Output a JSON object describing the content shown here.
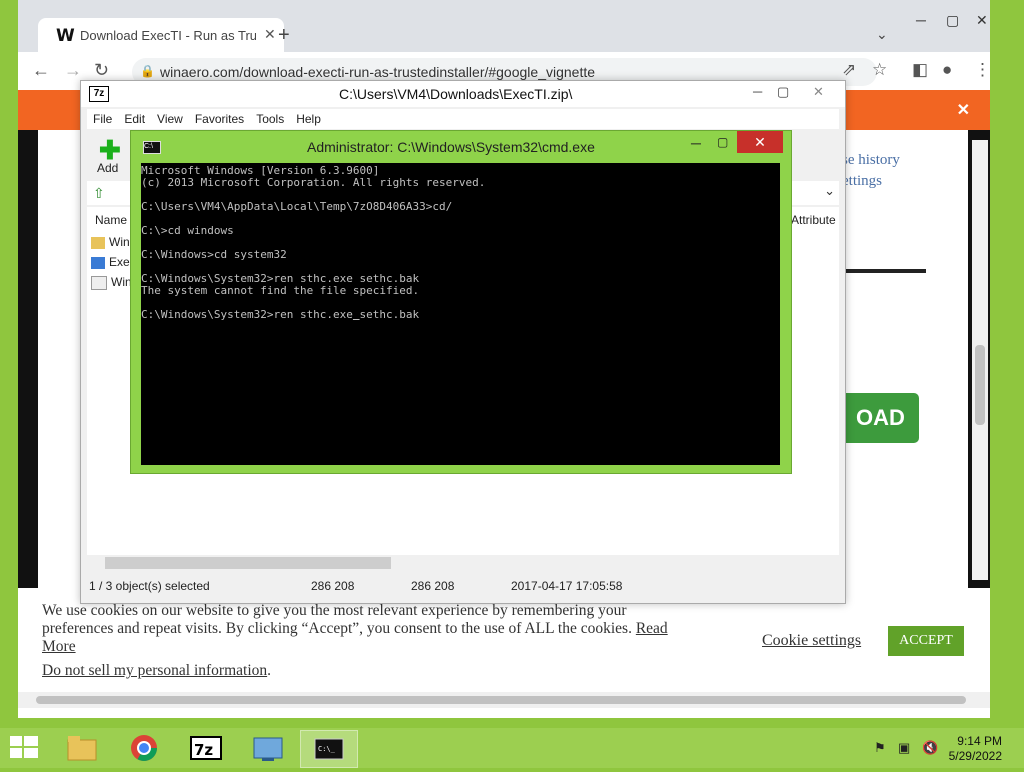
{
  "browser": {
    "tab_title": "Download ExecTI - Run as TrustedInstaller",
    "tab_favicon": "W",
    "url": "winaero.com/download-execti-run-as-trustedinstaller/#google_vignette"
  },
  "web": {
    "link1": "se history",
    "link2": "ettings",
    "download_label": "OAD",
    "cookie_message": "We use cookies on our website to give you the most relevant experience by remembering your preferences and repeat visits. By clicking “Accept”, you consent to the use of ALL the cookies.",
    "read_more": "Read More",
    "do_not_sell": "Do not sell my personal information",
    "cookie_settings": "Cookie settings",
    "accept": "ACCEPT"
  },
  "zip": {
    "title": "C:\\Users\\VM4\\Downloads\\ExecTI.zip\\",
    "menu": [
      "File",
      "Edit",
      "View",
      "Favorites",
      "Tools",
      "Help"
    ],
    "add_label": "Add",
    "col_name": "Name",
    "col_attributes": "Attribute",
    "rows": [
      "Win",
      "Exec",
      "Win"
    ],
    "status_selected": "1 / 3 object(s) selected",
    "status_size1": "286 208",
    "status_size2": "286 208",
    "status_date": "2017-04-17 17:05:58"
  },
  "cmd": {
    "title": "Administrator: C:\\Windows\\System32\\cmd.exe",
    "lines": [
      "Microsoft Windows [Version 6.3.9600]",
      "(c) 2013 Microsoft Corporation. All rights reserved.",
      "",
      "C:\\Users\\VM4\\AppData\\Local\\Temp\\7zO8D406A33>cd/",
      "",
      "C:\\>cd windows",
      "",
      "C:\\Windows>cd system32",
      "",
      "C:\\Windows\\System32>ren sthc.exe sethc.bak",
      "The system cannot find the file specified.",
      "",
      "C:\\Windows\\System32>ren sthc.exe sethc.bak"
    ]
  },
  "taskbar": {
    "time": "9:14 PM",
    "date": "5/29/2022",
    "apps": [
      "file-explorer",
      "chrome",
      "7-zip",
      "control-panel",
      "cmd"
    ]
  }
}
